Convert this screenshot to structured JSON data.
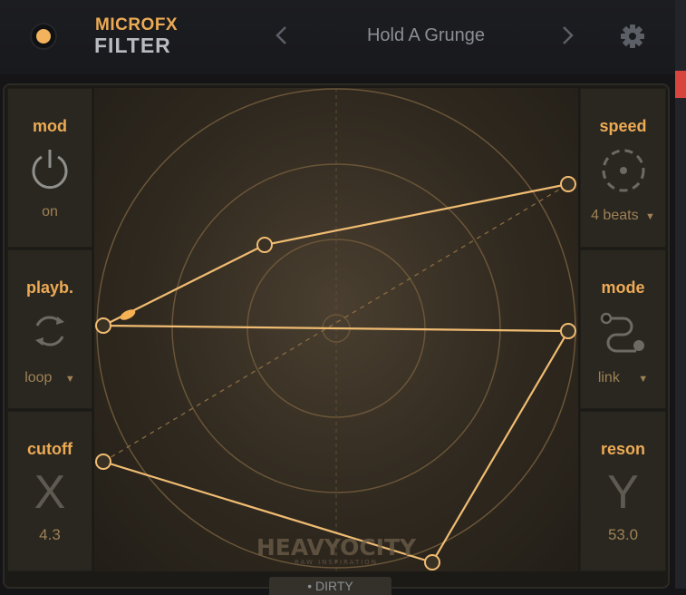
{
  "header": {
    "brand_line1": "MICROFX",
    "brand_line2": "FILTER",
    "preset_name": "Hold A Grunge",
    "prev_icon": "chevron-left-icon",
    "next_icon": "chevron-right-icon",
    "settings_icon": "gear-icon"
  },
  "left": {
    "mod": {
      "label": "mod",
      "value": "on",
      "icon": "power-icon"
    },
    "playback": {
      "label": "playb.",
      "value": "loop",
      "icon": "loop-icon"
    },
    "cutoff": {
      "label": "cutoff",
      "axis": "X",
      "value": "4.3"
    }
  },
  "right": {
    "speed": {
      "label": "speed",
      "value": "4 beats",
      "icon": "speed-dial-icon"
    },
    "mode": {
      "label": "mode",
      "value": "link",
      "icon": "link-path-icon"
    },
    "reson": {
      "label": "reson",
      "axis": "Y",
      "value": "53.0"
    }
  },
  "pad": {
    "logo": "HEAVYOCITY",
    "logo_sub": "RAW INSPIRATION"
  },
  "bottom_tab": "• DIRTY",
  "colors": {
    "accent": "#ecaa55",
    "muted": "#9e8155",
    "panel": "#2a2720"
  }
}
